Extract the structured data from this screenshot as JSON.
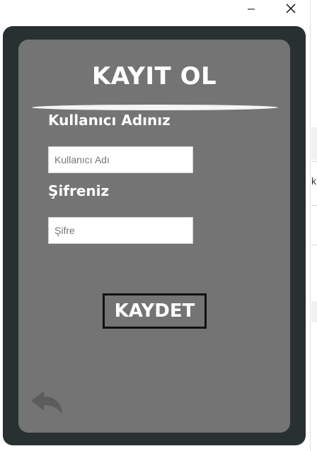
{
  "window": {
    "minimize_icon": "minimize-icon",
    "close_icon": "close-icon"
  },
  "form": {
    "title": "KAYIT OL",
    "username_label": "Kullanıcı Adınız",
    "username_placeholder": "Kullanıcı Adı",
    "username_value": "",
    "password_label": "Şifreniz",
    "password_placeholder": "Şifre",
    "password_value": "",
    "save_label": "KAYDET",
    "back_icon": "back-arrow-icon"
  },
  "background_app": {
    "visible_char": "k"
  },
  "colors": {
    "frame": "#293031",
    "panel": "#747474",
    "text": "#ffffff",
    "button_border": "#111111"
  }
}
